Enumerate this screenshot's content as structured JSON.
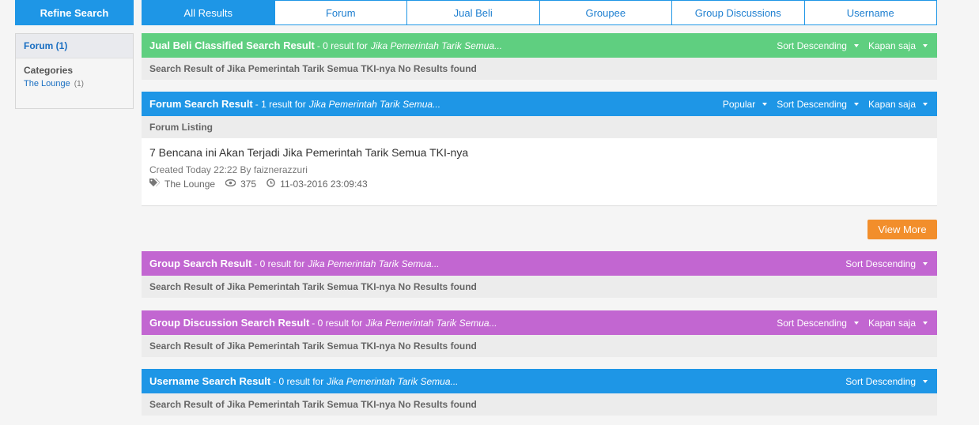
{
  "sidebar": {
    "refine_label": "Refine Search",
    "forum_filter": "Forum (1)",
    "categories_label": "Categories",
    "category_item": "The Lounge",
    "category_count": "(1)"
  },
  "tabs": [
    "All Results",
    "Forum",
    "Jual Beli",
    "Groupee",
    "Group Discussions",
    "Username"
  ],
  "query": "Jika Pemerintah Tarik Semua...",
  "no_results_text": "Search Result of Jika Pemerintah Tarik Semua TKI-nya No Results found",
  "sections": {
    "jualbeli": {
      "title": "Jual Beli Classified Search Result",
      "sub": "- 0 result for",
      "sort": "Sort Descending",
      "time": "Kapan saja"
    },
    "forum": {
      "title": "Forum Search Result",
      "sub": "- 1 result for",
      "popular": "Popular",
      "sort": "Sort Descending",
      "time": "Kapan saja",
      "body_label": "Forum Listing",
      "thread": {
        "title": "7 Bencana ini Akan Terjadi Jika Pemerintah Tarik Semua TKI-nya",
        "meta": "Created Today 22:22 By faiznerazzuri",
        "category": "The Lounge",
        "views": "375",
        "date": "11-03-2016 23:09:43"
      },
      "view_more": "View More"
    },
    "group": {
      "title": "Group Search Result",
      "sub": "- 0 result for",
      "sort": "Sort Descending"
    },
    "groupdisc": {
      "title": "Group Discussion Search Result",
      "sub": "- 0 result for",
      "sort": "Sort Descending",
      "time": "Kapan saja"
    },
    "username": {
      "title": "Username Search Result",
      "sub": "- 0 result for",
      "sort": "Sort Descending"
    }
  },
  "colors": {
    "green": "#5fcf80",
    "blue": "#1e96e6",
    "purple": "#c266d1",
    "orange": "#f28e2b"
  }
}
